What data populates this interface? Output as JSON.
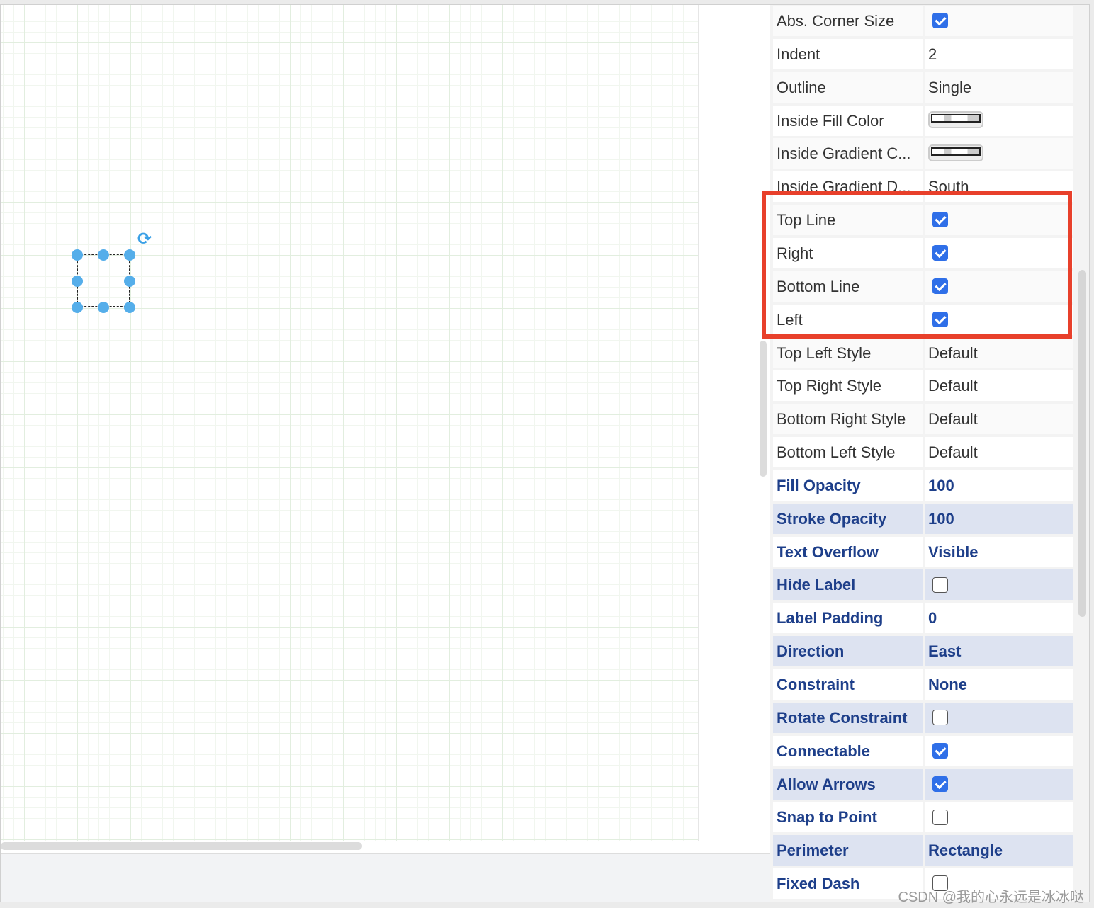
{
  "properties": [
    {
      "label": "Abs. Corner Size",
      "type": "checkbox",
      "checked": true,
      "style": "plain"
    },
    {
      "label": "Indent",
      "value": "2",
      "style": "plain"
    },
    {
      "label": "Outline",
      "value": "Single",
      "style": "plain"
    },
    {
      "label": "Inside Fill Color",
      "type": "color",
      "style": "plain"
    },
    {
      "label": "Inside Gradient C...",
      "type": "color",
      "style": "plain"
    },
    {
      "label": "Inside Gradient D...",
      "value": "South",
      "style": "plain"
    },
    {
      "label": "Top Line",
      "type": "checkbox",
      "checked": true,
      "style": "plain"
    },
    {
      "label": "Right",
      "type": "checkbox",
      "checked": true,
      "style": "plain"
    },
    {
      "label": "Bottom Line",
      "type": "checkbox",
      "checked": true,
      "style": "plain"
    },
    {
      "label": "Left",
      "type": "checkbox",
      "checked": true,
      "style": "plain"
    },
    {
      "label": "Top Left Style",
      "value": "Default",
      "style": "plain"
    },
    {
      "label": "Top Right Style",
      "value": "Default",
      "style": "plain"
    },
    {
      "label": "Bottom Right Style",
      "value": "Default",
      "style": "plain"
    },
    {
      "label": "Bottom Left Style",
      "value": "Default",
      "style": "plain"
    },
    {
      "label": "Fill Opacity",
      "value": "100",
      "style": "bold"
    },
    {
      "label": "Stroke Opacity",
      "value": "100",
      "style": "bold"
    },
    {
      "label": "Text Overflow",
      "value": "Visible",
      "style": "bold"
    },
    {
      "label": "Hide Label",
      "type": "checkbox",
      "checked": false,
      "style": "bold"
    },
    {
      "label": "Label Padding",
      "value": "0",
      "style": "bold"
    },
    {
      "label": "Direction",
      "value": "East",
      "style": "bold"
    },
    {
      "label": "Constraint",
      "value": "None",
      "style": "bold"
    },
    {
      "label": "Rotate Constraint",
      "type": "checkbox",
      "checked": false,
      "style": "bold"
    },
    {
      "label": "Connectable",
      "type": "checkbox",
      "checked": true,
      "style": "bold"
    },
    {
      "label": "Allow Arrows",
      "type": "checkbox",
      "checked": true,
      "style": "bold"
    },
    {
      "label": "Snap to Point",
      "type": "checkbox",
      "checked": false,
      "style": "bold"
    },
    {
      "label": "Perimeter",
      "value": "Rectangle",
      "style": "bold"
    },
    {
      "label": "Fixed Dash",
      "type": "checkbox",
      "checked": false,
      "style": "bold"
    }
  ],
  "highlight_color": "#e8402b",
  "accent_color": "#2f6fe8",
  "selection_color": "#55aeea",
  "rotate_icon": "rotate-icon",
  "watermark": "CSDN @我的心永远是冰冰哒"
}
